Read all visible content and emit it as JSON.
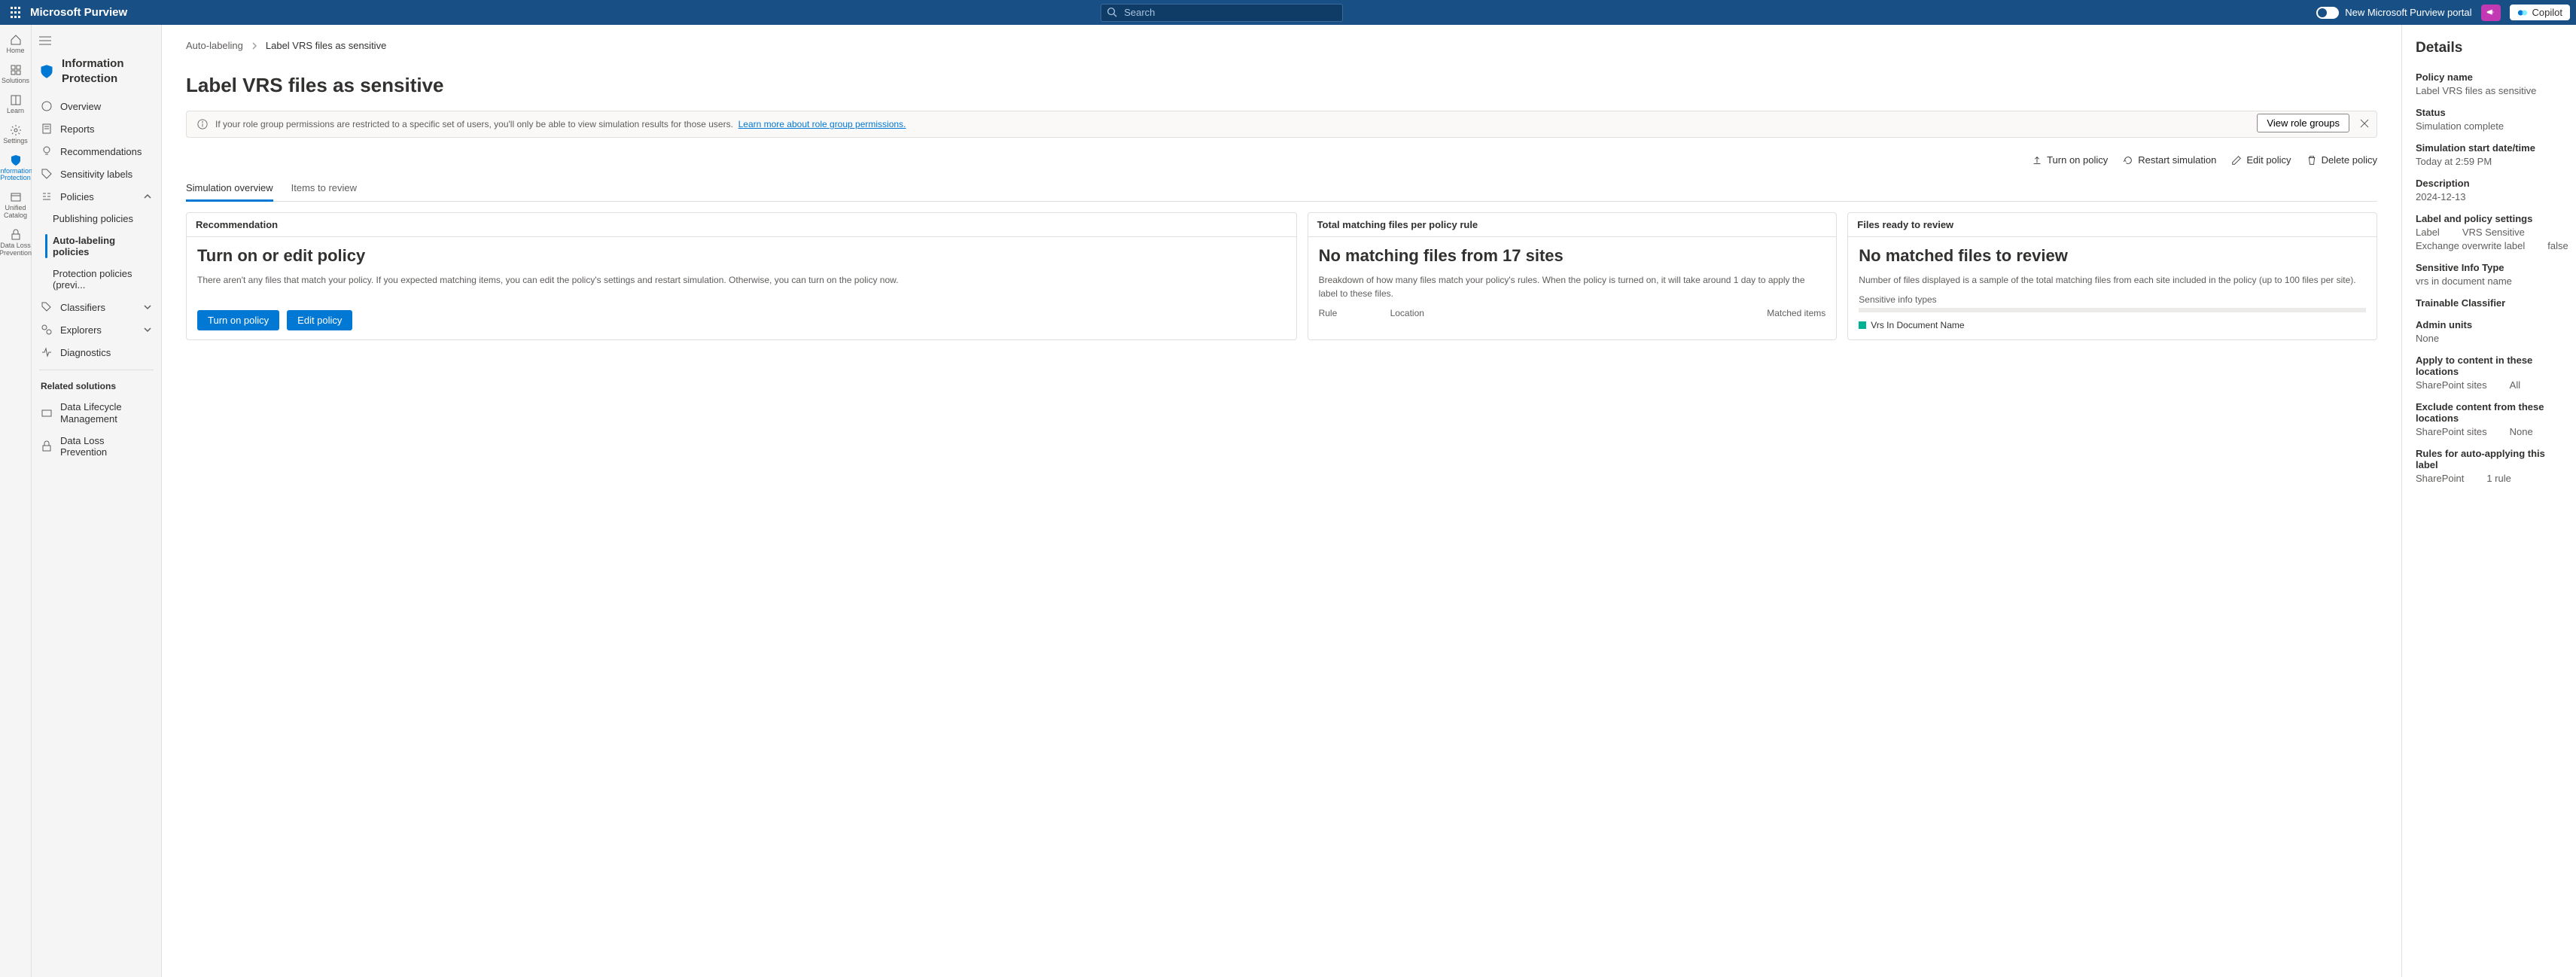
{
  "header": {
    "brand": "Microsoft Purview",
    "search_placeholder": "Search",
    "toggle_label": "New Microsoft Purview portal",
    "copilot_label": "Copilot"
  },
  "rail": [
    {
      "label": "Home"
    },
    {
      "label": "Solutions"
    },
    {
      "label": "Learn"
    },
    {
      "label": "Settings"
    },
    {
      "label": "Information Protection",
      "active": true
    },
    {
      "label": "Unified Catalog"
    },
    {
      "label": "Data Loss Prevention"
    }
  ],
  "sidenav": {
    "title": "Information Protection",
    "items": [
      {
        "label": "Overview"
      },
      {
        "label": "Reports"
      },
      {
        "label": "Recommendations"
      },
      {
        "label": "Sensitivity labels"
      },
      {
        "label": "Policies",
        "expanded": true,
        "children": [
          {
            "label": "Publishing policies"
          },
          {
            "label": "Auto-labeling policies",
            "active": true
          },
          {
            "label": "Protection policies (previ..."
          }
        ]
      },
      {
        "label": "Classifiers",
        "expandable": true
      },
      {
        "label": "Explorers",
        "expandable": true
      },
      {
        "label": "Diagnostics"
      }
    ],
    "related_title": "Related solutions",
    "related": [
      {
        "label": "Data Lifecycle Management"
      },
      {
        "label": "Data Loss Prevention"
      }
    ]
  },
  "breadcrumb": {
    "root": "Auto-labeling",
    "leaf": "Label VRS files as sensitive"
  },
  "page_title": "Label VRS files as sensitive",
  "banner": {
    "text": "If your role group permissions are restricted to a specific set of users, you'll only be able to view simulation results for those users.",
    "link": "Learn more about role group permissions.",
    "button": "View role groups"
  },
  "toolbar": {
    "turn_on": "Turn on policy",
    "restart": "Restart simulation",
    "edit": "Edit policy",
    "delete": "Delete policy"
  },
  "tabs": [
    {
      "label": "Simulation overview",
      "active": true
    },
    {
      "label": "Items to review"
    }
  ],
  "cards": {
    "rec": {
      "header": "Recommendation",
      "title": "Turn on or edit policy",
      "body": "There aren't any files that match your policy. If you expected matching items, you can edit the policy's settings and restart simulation. Otherwise, you can turn on the policy now.",
      "turn_on": "Turn on policy",
      "edit": "Edit policy"
    },
    "matching": {
      "header": "Total matching files per policy rule",
      "title": "No matching files from 17 sites",
      "body": "Breakdown of how many files match your policy's rules. When the policy is turned on, it will take around 1 day to apply the label to these files.",
      "col_rule": "Rule",
      "col_location": "Location",
      "col_matched": "Matched items"
    },
    "ready": {
      "header": "Files ready to review",
      "title": "No matched files to review",
      "body": "Number of files displayed is a sample of the total matching files from each site included in the policy (up to 100 files per site).",
      "sit_label": "Sensitive info types",
      "legend": "Vrs In Document Name"
    }
  },
  "details": {
    "heading": "Details",
    "fields": {
      "policy_name_k": "Policy name",
      "policy_name_v": "Label VRS files as sensitive",
      "status_k": "Status",
      "status_v": "Simulation complete",
      "start_k": "Simulation start date/time",
      "start_v": "Today at 2:59 PM",
      "desc_k": "Description",
      "desc_v": "2024-12-13",
      "label_settings_k": "Label and policy settings",
      "label_k": "Label",
      "label_v": "VRS Sensitive",
      "overwrite_k": "Exchange overwrite label",
      "overwrite_v": "false",
      "sit_k": "Sensitive Info Type",
      "sit_v": "vrs in document name",
      "trainable_k": "Trainable Classifier",
      "admin_k": "Admin units",
      "admin_v": "None",
      "apply_k": "Apply to content in these locations",
      "apply_loc": "SharePoint sites",
      "apply_val": "All",
      "exclude_k": "Exclude content from these locations",
      "exclude_loc": "SharePoint sites",
      "exclude_val": "None",
      "rules_k": "Rules for auto-applying this label",
      "rules_loc": "SharePoint",
      "rules_val": "1 rule"
    }
  },
  "chart_data": {
    "type": "bar",
    "title": "Sensitive info types",
    "categories": [
      "Vrs In Document Name"
    ],
    "values": [
      0
    ],
    "ylim": [
      0,
      100
    ]
  }
}
